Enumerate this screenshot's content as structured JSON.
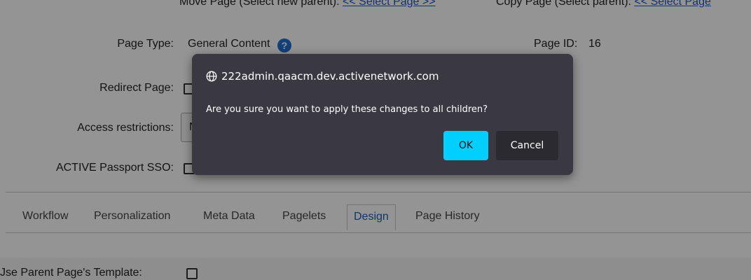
{
  "top_row": {
    "move_page_label": "Move Page (Select new parent):",
    "move_page_link": "<< Select Page >>",
    "copy_page_label": "Copy Page (Select parent):",
    "copy_page_link": "<< Select Page"
  },
  "form": {
    "page_type_label": "Page Type:",
    "page_type_value": "General Content",
    "help_icon": "?",
    "page_id_label": "Page ID:",
    "page_id_value": "16",
    "redirect_label": "Redirect Page:",
    "access_label": "Access restrictions:",
    "access_select_value": "N",
    "sso_label": "ACTIVE Passport SSO:"
  },
  "tabs": [
    {
      "label": "Workflow"
    },
    {
      "label": "Personalization"
    },
    {
      "label": "Meta Data"
    },
    {
      "label": "Pagelets"
    },
    {
      "label": "Design",
      "active": true
    },
    {
      "label": "Page History"
    }
  ],
  "design": {
    "use_parent_template_label": "Jse Parent Page's Template:"
  },
  "dialog": {
    "origin": "222admin.qaacm.dev.activenetwork.com",
    "message": "Are you sure you want to apply these changes to all children?",
    "ok_label": "OK",
    "cancel_label": "Cancel"
  },
  "colors": {
    "ok_button": "#00cfff",
    "dialog_bg": "#3a3942",
    "link": "#1a56c9",
    "active_tab": "#1a5fb4"
  }
}
